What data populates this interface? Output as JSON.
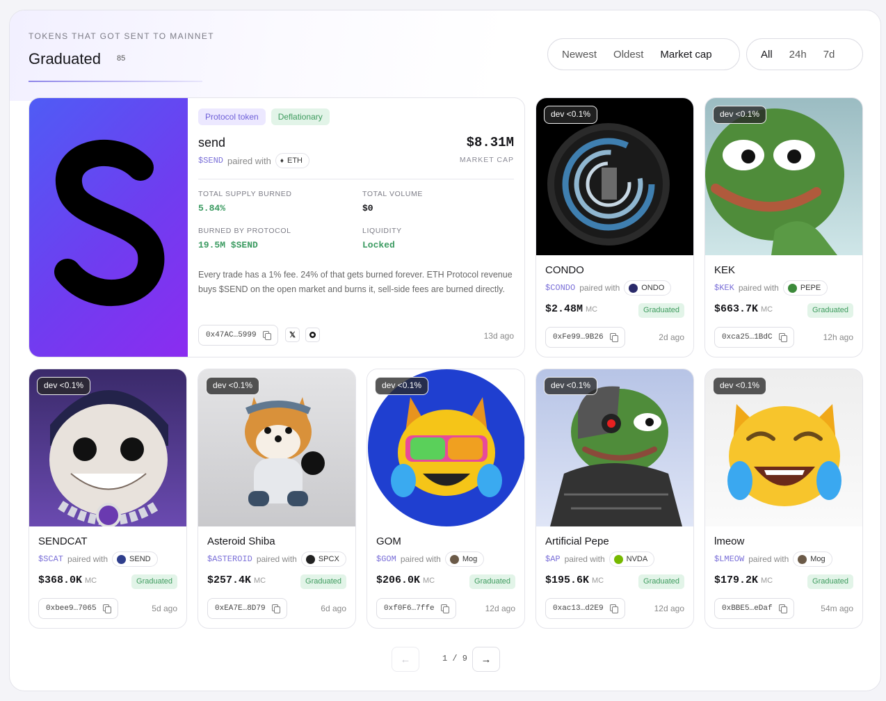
{
  "header": {
    "eyebrow": "TOKENS THAT GOT SENT TO MAINNET",
    "title": "Graduated",
    "count": "85"
  },
  "sort_tabs": [
    {
      "label": "Newest",
      "active": false
    },
    {
      "label": "Oldest",
      "active": false
    },
    {
      "label": "Market cap",
      "active": true
    }
  ],
  "range_tabs": [
    {
      "label": "All",
      "active": true
    },
    {
      "label": "24h",
      "active": false
    },
    {
      "label": "7d",
      "active": false
    }
  ],
  "featured": {
    "tags": [
      "Protocol token",
      "Deflationary"
    ],
    "name": "send",
    "ticker": "$SEND",
    "paired_with": "paired with",
    "pair": "ETH",
    "market_cap": "$8.31M",
    "market_cap_label": "MARKET CAP",
    "stats": {
      "supply_burned_label": "TOTAL SUPPLY BURNED",
      "supply_burned": "5.84%",
      "volume_label": "TOTAL VOLUME",
      "volume": "$0",
      "burned_by_protocol_label": "BURNED BY PROTOCOL",
      "burned_by_protocol": "19.5M $SEND",
      "liquidity_label": "LIQUIDITY",
      "liquidity": "Locked"
    },
    "description": "Every trade has a 1% fee. 24% of that gets burned forever. ETH Protocol revenue buys $SEND on the open market and burns it, sell-side fees are burned directly.",
    "address": "0x47AC…5999",
    "age": "13d ago",
    "hero_color_from": "#4f5cf5",
    "hero_color_to": "#8b2cf0"
  },
  "cards": [
    {
      "dev": "dev <0.1%",
      "name": "CONDO",
      "ticker": "$CONDO",
      "pair": "ONDO",
      "pair_color": "#2a2a6a",
      "mc": "$2.48M",
      "status": "Graduated",
      "address": "0xFe99…9B26",
      "age": "2d ago"
    },
    {
      "dev": "dev <0.1%",
      "name": "KEK",
      "ticker": "$KEK",
      "pair": "PEPE",
      "pair_color": "#3c8a3a",
      "mc": "$663.7K",
      "status": "Graduated",
      "address": "0xca25…1BdC",
      "age": "12h ago"
    },
    {
      "dev": "dev <0.1%",
      "name": "SENDCAT",
      "ticker": "$SCAT",
      "pair": "SEND",
      "pair_color": "#2f3e8c",
      "mc": "$368.0K",
      "status": "Graduated",
      "address": "0xbee9…7065",
      "age": "5d ago"
    },
    {
      "dev": "dev <0.1%",
      "name": "Asteroid Shiba",
      "ticker": "$ASTEROID",
      "pair": "SPCX",
      "pair_color": "#222222",
      "mc": "$257.4K",
      "status": "Graduated",
      "address": "0xEA7E…8D79",
      "age": "6d ago"
    },
    {
      "dev": "dev <0.1%",
      "name": "GOM",
      "ticker": "$GOM",
      "pair": "Mog",
      "pair_color": "#6b5a48",
      "mc": "$206.0K",
      "status": "Graduated",
      "address": "0xf0F6…7ffe",
      "age": "12d ago"
    },
    {
      "dev": "dev <0.1%",
      "name": "Artificial Pepe",
      "ticker": "$AP",
      "pair": "NVDA",
      "pair_color": "#76b900",
      "mc": "$195.6K",
      "status": "Graduated",
      "address": "0xac13…d2E9",
      "age": "12d ago"
    },
    {
      "dev": "dev <0.1%",
      "name": "lmeow",
      "ticker": "$LMEOW",
      "pair": "Mog",
      "pair_color": "#6b5a48",
      "mc": "$179.2K",
      "status": "Graduated",
      "address": "0xBBE5…eDaf",
      "age": "54m ago"
    }
  ],
  "common": {
    "paired_with": "paired with",
    "mc_unit": "MC"
  },
  "pagination": {
    "prev": "←",
    "next": "→",
    "current": "1 / 9"
  }
}
